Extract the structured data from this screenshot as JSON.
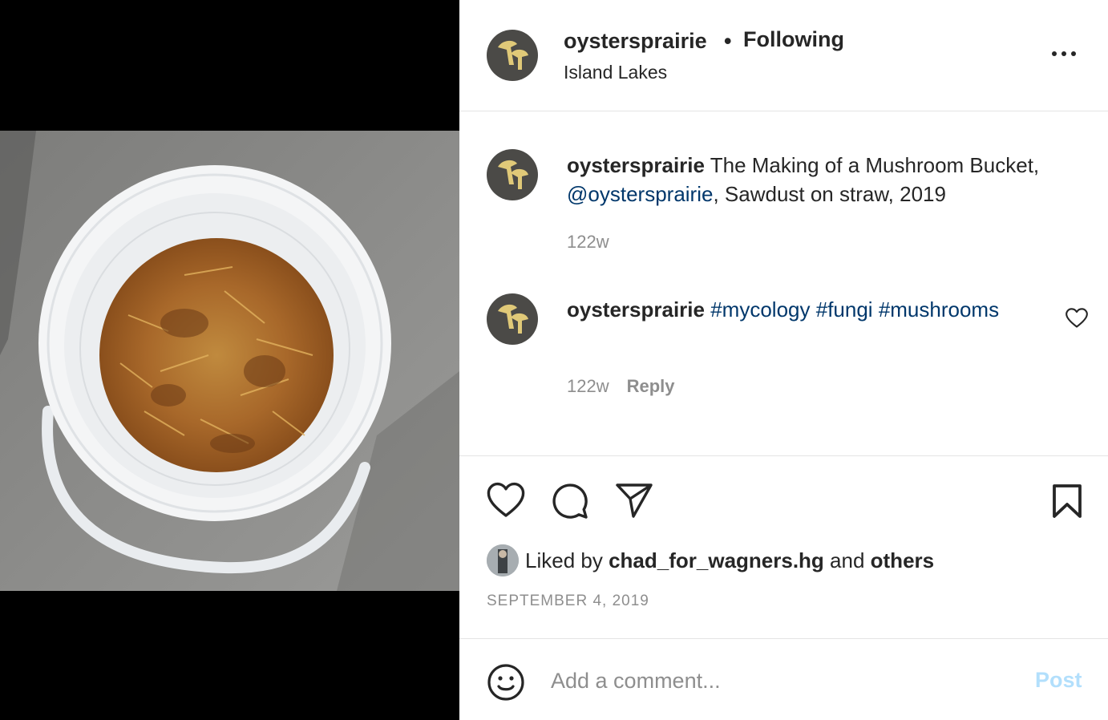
{
  "post": {
    "username": "oystersprairie",
    "separator": "•",
    "follow_status": "Following",
    "location": "Island Lakes",
    "more_icon": "more-horizontal-icon",
    "image_description_icon": "bucket-photo"
  },
  "caption": {
    "username": "oystersprairie",
    "text_before": " The Making of a Mushroom Bucket, ",
    "mention": "@oystersprairie",
    "text_after": ", Sawdust on straw, 2019",
    "age": "122w"
  },
  "comments": [
    {
      "username": "oystersprairie",
      "tags": [
        "#mycology",
        "#fungi",
        "#mushrooms"
      ],
      "age": "122w",
      "reply_label": "Reply"
    }
  ],
  "actions": {
    "like_icon": "heart-icon",
    "comment_icon": "comment-icon",
    "share_icon": "send-icon",
    "save_icon": "bookmark-icon"
  },
  "likes": {
    "prefix": "Liked by ",
    "user": "chad_for_wagners.hg",
    "middle": " and ",
    "others": "others"
  },
  "date": "SEPTEMBER 4, 2019",
  "add_comment": {
    "placeholder": "Add a comment...",
    "post_label": "Post"
  },
  "colors": {
    "link": "#00376b",
    "muted": "#8e8e8e",
    "post_disabled": "#b2dffc",
    "text": "#262626"
  }
}
